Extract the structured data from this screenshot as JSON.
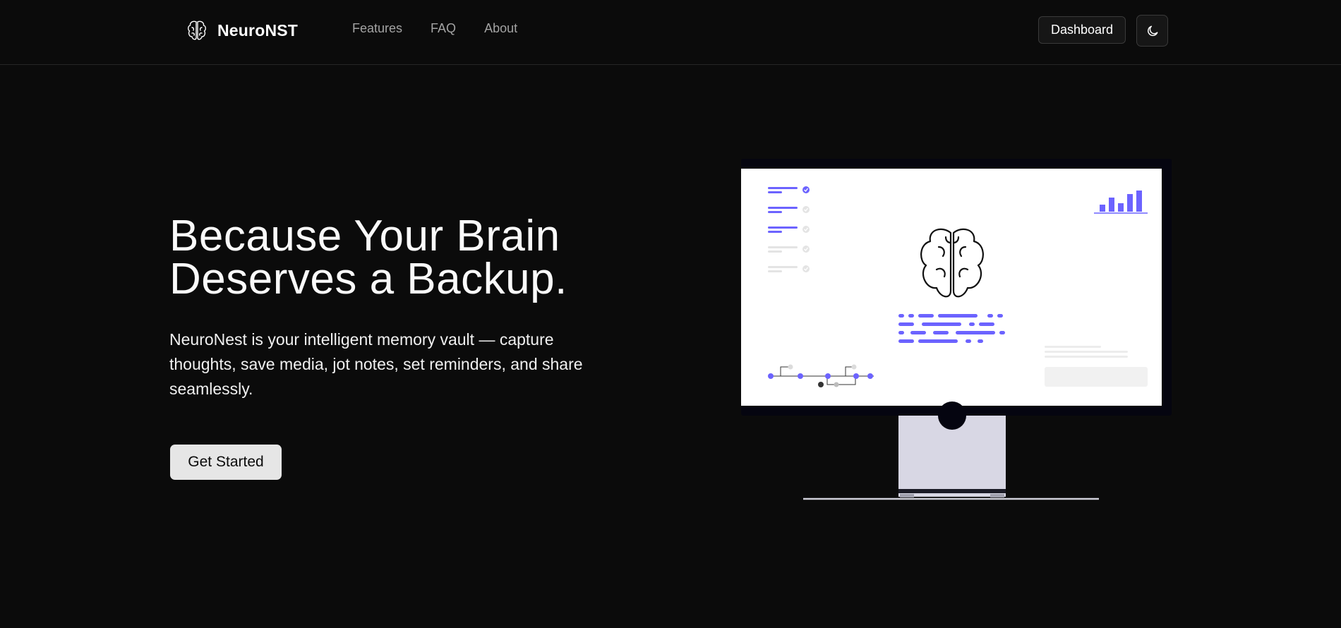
{
  "nav": {
    "brand_name": "NeuroNST",
    "links": [
      "Features",
      "FAQ",
      "About"
    ],
    "dashboard_label": "Dashboard"
  },
  "hero": {
    "title_line1": "Because Your Brain",
    "title_line2": "Deserves a Backup.",
    "subtitle": "NeuroNest is your intelligent memory vault — capture thoughts, save media, jot notes, set reminders, and share seamlessly.",
    "cta_label": "Get Started"
  },
  "colors": {
    "background": "#0b0b0b",
    "accent": "#6c63ff",
    "cta_bg": "#e6e6e6",
    "monitor_stand": "#d8d7e4"
  },
  "icons": {
    "brand": "brain-icon",
    "theme_toggle": "moon-icon"
  }
}
